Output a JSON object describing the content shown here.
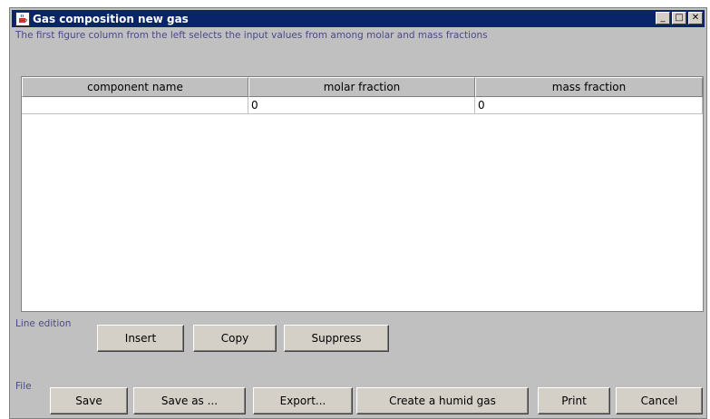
{
  "window": {
    "title": "Gas composition new gas",
    "controls": {
      "minimize": "_",
      "maximize": "□",
      "close": "✕"
    }
  },
  "hint": "The first figure column from the left selects the input values from among molar and mass fractions",
  "table": {
    "headers": [
      "component name",
      "molar fraction",
      "mass fraction"
    ],
    "rows": [
      [
        "",
        "0",
        "0"
      ]
    ]
  },
  "line_edition": {
    "label": "Line edition",
    "insert": "Insert",
    "copy": "Copy",
    "suppress": "Suppress"
  },
  "file": {
    "label": "File",
    "save": "Save",
    "save_as": "Save as ...",
    "export": "Export...",
    "create_humid_gas": "Create a humid gas",
    "print": "Print",
    "cancel": "Cancel"
  }
}
